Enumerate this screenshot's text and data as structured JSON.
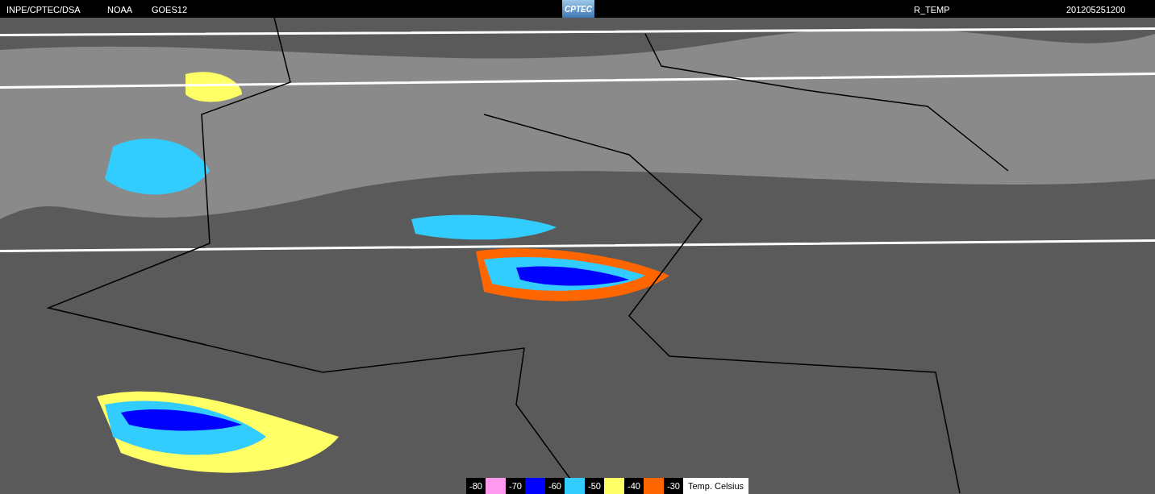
{
  "header": {
    "source": "INPE/CPTEC/DSA",
    "agency": "NOAA",
    "satellite": "GOES12",
    "logo": "CPTEC",
    "product": "R_TEMP",
    "timestamp": "201205251200"
  },
  "legend": {
    "ticks": [
      "-80",
      "-70",
      "-60",
      "-50",
      "-40",
      "-30"
    ],
    "bands": [
      {
        "color": "#ff99ee"
      },
      {
        "color": "#0000ff"
      },
      {
        "color": "#33ccff"
      },
      {
        "color": "#ffff66"
      },
      {
        "color": "#ff6600"
      }
    ],
    "unit": "Temp. Celsius"
  }
}
